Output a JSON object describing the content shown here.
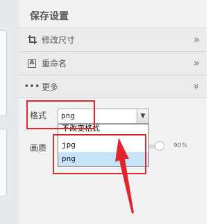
{
  "panel": {
    "title": "保存设置",
    "sections": [
      {
        "icon": "crop-icon",
        "label": "修改尺寸",
        "chevron": "»"
      },
      {
        "icon": "rename-icon",
        "label": "重命名",
        "chevron": "»"
      },
      {
        "icon": "more-dots-icon",
        "label": "更多",
        "chevron": "»"
      }
    ]
  },
  "format": {
    "label": "格式",
    "selected": "png",
    "arrow": "▼",
    "options": [
      "不改变格式",
      "jpg",
      "png"
    ],
    "highlighted_option": "png"
  },
  "quality": {
    "label": "画质",
    "value": "90%",
    "level": 0.9
  },
  "annotation": {
    "color": "#e0262c"
  }
}
